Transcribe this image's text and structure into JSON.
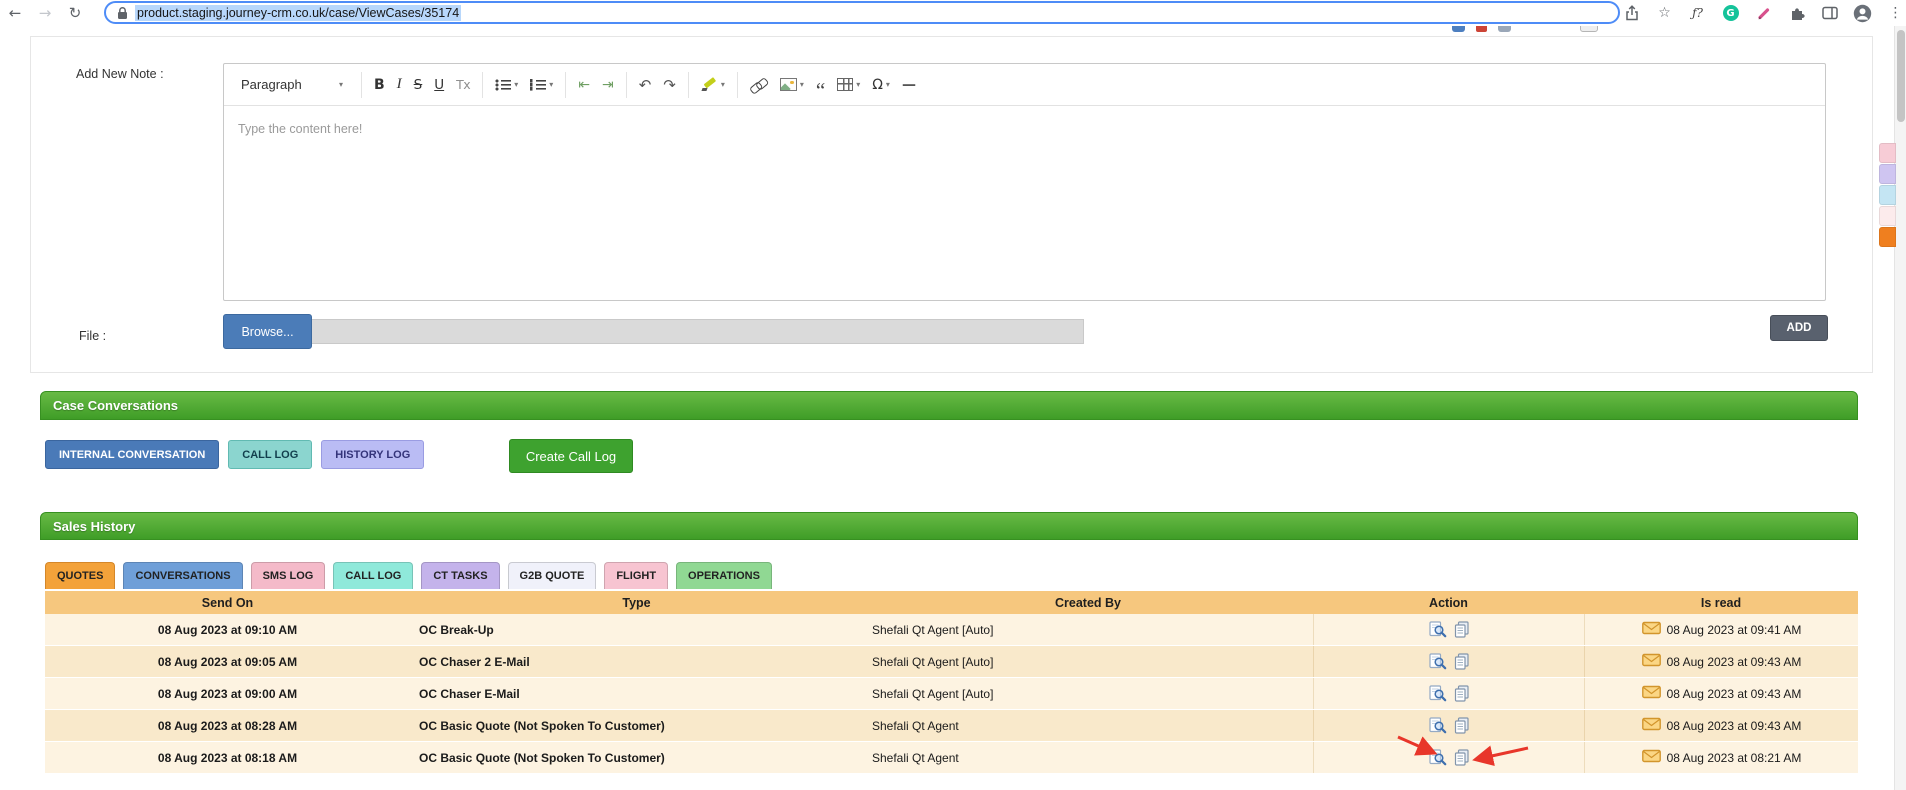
{
  "browser": {
    "url": "product.staging.journey-crm.co.uk/case/ViewCases/35174",
    "back_icon": "←",
    "forward_icon": "→",
    "reload_icon": "↻",
    "star_icon": "☆",
    "menu_icon": "⋮",
    "fn_extension_badge": "ƒ?",
    "grammarly_letter": "G"
  },
  "note": {
    "label": "Add New Note :",
    "placeholder": "Type the content here!",
    "file_label": "File :",
    "browse_button": "Browse...",
    "add_button": "ADD",
    "toolbar": {
      "paragraph_label": "Paragraph",
      "chevron": "▾",
      "items": [
        {
          "name": "bold",
          "glyph": "B"
        },
        {
          "name": "italic",
          "glyph": "I"
        },
        {
          "name": "strikethrough",
          "glyph": "S"
        },
        {
          "name": "underline",
          "glyph": "U"
        },
        {
          "name": "remove-format",
          "glyph": "Tx"
        },
        {
          "name": "separator"
        },
        {
          "name": "bulleted-list",
          "dropdown": true
        },
        {
          "name": "numbered-list",
          "dropdown": true
        },
        {
          "name": "separator"
        },
        {
          "name": "decrease-indent",
          "glyph": "⇤"
        },
        {
          "name": "increase-indent",
          "glyph": "⇥"
        },
        {
          "name": "separator"
        },
        {
          "name": "undo",
          "glyph": "↶"
        },
        {
          "name": "redo",
          "glyph": "↷"
        },
        {
          "name": "separator"
        },
        {
          "name": "highlight",
          "dropdown": true
        },
        {
          "name": "separator"
        },
        {
          "name": "link"
        },
        {
          "name": "insert-image",
          "dropdown": true
        },
        {
          "name": "block-quote",
          "glyph": "“"
        },
        {
          "name": "insert-table",
          "dropdown": true
        },
        {
          "name": "special-characters",
          "glyph": "Ω",
          "dropdown": true
        },
        {
          "name": "horizontal-line",
          "glyph": "—"
        }
      ]
    }
  },
  "conversations": {
    "title": "Case Conversations",
    "buttons": [
      {
        "label": "INTERNAL CONVERSATION",
        "bg": "#4a7ab8",
        "fg": "#ffffff",
        "border": "#3a659e"
      },
      {
        "label": "CALL LOG",
        "bg": "#8bd5cf",
        "fg": "#123f4d",
        "border": "#61bab2"
      },
      {
        "label": "HISTORY LOG",
        "bg": "#babcf4",
        "fg": "#34347a",
        "border": "#9a9ce2"
      }
    ],
    "create_call_log": "Create Call Log"
  },
  "sales": {
    "title": "Sales History",
    "tabs": [
      {
        "label": "QUOTES",
        "bg": "#f3a23a",
        "active": true
      },
      {
        "label": "CONVERSATIONS",
        "bg": "#6f9fd8"
      },
      {
        "label": "SMS LOG",
        "bg": "#f4bac9"
      },
      {
        "label": "CALL LOG",
        "bg": "#8fe9da"
      },
      {
        "label": "CT TASKS",
        "bg": "#c4b3eb"
      },
      {
        "label": "G2B QUOTE",
        "bg": "#f0f1fa"
      },
      {
        "label": "FLIGHT",
        "bg": "#f7c4d1"
      },
      {
        "label": "OPERATIONS",
        "bg": "#90d893"
      }
    ],
    "table": {
      "columns": [
        "Send On",
        "Type",
        "Created By",
        "Action",
        "Is read"
      ],
      "rows": [
        {
          "send_on": "08 Aug 2023 at 09:10 AM",
          "type": "OC Break-Up",
          "created_by": "Shefali Qt Agent [Auto]",
          "is_read": "08 Aug 2023 at 09:41 AM"
        },
        {
          "send_on": "08 Aug 2023 at 09:05 AM",
          "type": "OC Chaser 2 E-Mail",
          "created_by": "Shefali Qt Agent [Auto]",
          "is_read": "08 Aug 2023 at 09:43 AM"
        },
        {
          "send_on": "08 Aug 2023 at 09:00 AM",
          "type": "OC Chaser E-Mail",
          "created_by": "Shefali Qt Agent [Auto]",
          "is_read": "08 Aug 2023 at 09:43 AM"
        },
        {
          "send_on": "08 Aug 2023 at 08:28 AM",
          "type": "OC Basic Quote (Not Spoken To Customer)",
          "created_by": "Shefali Qt Agent",
          "is_read": "08 Aug 2023 at 09:43 AM"
        },
        {
          "send_on": "08 Aug 2023 at 08:18 AM",
          "type": "OC Basic Quote (Not Spoken To Customer)",
          "created_by": "Shefali Qt Agent",
          "is_read": "08 Aug 2023 at 08:21 AM"
        }
      ]
    }
  },
  "side_widget": {
    "colors": [
      "#f7ccd6",
      "#cfc5f1",
      "#c4e5f3",
      "#fcebec",
      "#ef7f1f"
    ]
  },
  "colors": {
    "section_header_top": "#68ba45",
    "section_header_bottom": "#3f9d27",
    "table_header_bg": "#f6c77e",
    "row_odd": "#fdf3e1",
    "row_even": "#f9e9cb",
    "url_selection": "#b8d7fb",
    "annotation_arrow": "#e8362a",
    "browse_button": "#4b7cb8",
    "add_button": "#59616e",
    "create_button": "#3ea22f"
  }
}
